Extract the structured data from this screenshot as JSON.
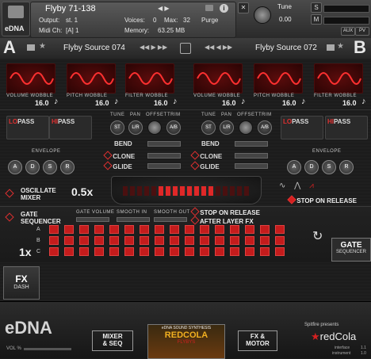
{
  "header": {
    "logo_text": "eDNA",
    "instrument_name": "Flyby 71-138",
    "output_label": "Output:",
    "output_value": "st. 1",
    "midi_label": "Midi Ch:",
    "midi_value": "[A] 1",
    "voices_label": "Voices:",
    "voices_value": "0",
    "max_label": "Max:",
    "max_value": "32",
    "memory_label": "Memory:",
    "memory_value": "63.25 MB",
    "purge_label": "Purge",
    "tune_label": "Tune",
    "tune_value": "0.00",
    "s_label": "S",
    "m_label": "M",
    "aux_label": "AUX",
    "pv_label": "PV"
  },
  "sources": {
    "a_letter": "A",
    "b_letter": "B",
    "a_name": "Flyby Source 074",
    "b_name": "Flyby Source 072"
  },
  "wobble_slots": [
    {
      "label": "VOLUME WOBBLE",
      "value": "16.0"
    },
    {
      "label": "PITCH WOBBLE",
      "value": "16.0"
    },
    {
      "label": "FILTER WOBBLE",
      "value": "16.0"
    },
    {
      "label": "VOLUME WOBBLE",
      "value": "16.0"
    },
    {
      "label": "PITCH WOBBLE",
      "value": "16.0"
    },
    {
      "label": "FILTER WOBBLE",
      "value": "16.0"
    }
  ],
  "filters": {
    "lo_pre": "LO",
    "lo_post": "PASS",
    "hi_pre": "HI",
    "hi_post": "PASS"
  },
  "envelope": {
    "label": "ENVELOPE",
    "buttons": [
      "A",
      "D",
      "S",
      "R"
    ]
  },
  "center": {
    "tune": "TUNE",
    "pan": "PAN",
    "offset": "OFFSET",
    "trim": "TRIM",
    "st": "ST",
    "lr": "L/R",
    "ab": "A/B",
    "bend": "BEND",
    "clone": "CLONE",
    "glide": "GLIDE"
  },
  "oscillate": {
    "mixer_line1": "OSCILLATE",
    "mixer_line2": "MIXER",
    "speed": "0.5x",
    "stop_on_release": "STOP ON RELEASE"
  },
  "gate": {
    "title_line1": "GATE",
    "title_line2": "SEQUENCER",
    "gate_volume": "GATE VOLUME",
    "smooth_in": "SMOOTH IN",
    "smooth_out": "SMOOTH OUT",
    "stop_on_release": "STOP ON RELEASE",
    "after_layer_fx": "AFTER LAYER FX",
    "rows": [
      "A",
      "B",
      "C"
    ],
    "multiplier": "1x",
    "steps": 16,
    "gate_seq_button_1": "GATE",
    "gate_seq_button_2": "SEQUENCER"
  },
  "fx_dash": {
    "line1": "FX",
    "line2": "DASH"
  },
  "bottom": {
    "logo": "eDNA",
    "vol": "VOL %",
    "mixer_seq_1": "MIXER",
    "mixer_seq_2": "& SEQ",
    "fx_motor_1": "FX &",
    "fx_motor_2": "MOTOR",
    "product_label": "eDNA SOUND SYNTHESIS",
    "product_name": "REDCOLA",
    "product_sub": "FLYBYS",
    "presents": "Spitfire presents",
    "brand": "redCola",
    "interface": "interface",
    "interface_version": "1.1",
    "instrument": "instrument",
    "instrument_version": "1.0"
  },
  "colors": {
    "accent": "#d42020",
    "panel": "#1c1c1c",
    "text": "#d8d8d8"
  }
}
